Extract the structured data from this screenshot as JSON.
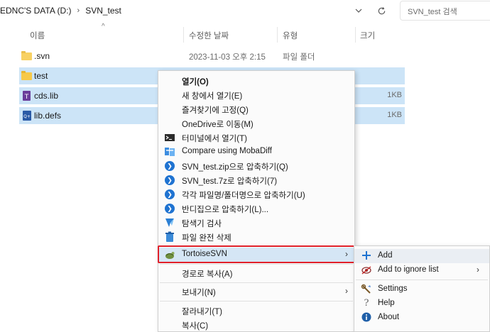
{
  "address": {
    "segments": [
      "EDNC'S DATA (D:)",
      "SVN_test"
    ],
    "separator": "›",
    "dropdown_icon": "chevron-down-icon",
    "refresh_icon": "refresh-icon"
  },
  "search": {
    "placeholder": "SVN_test 검색"
  },
  "columns": {
    "name": "이름",
    "modified": "수정한 날짜",
    "type": "유형",
    "size": "크기"
  },
  "files": [
    {
      "name": ".svn",
      "modified": "2023-11-03 오후 2:15",
      "type": "파일 폴더",
      "size": "",
      "icon": "folder-icon"
    },
    {
      "name": "test",
      "modified": "",
      "type": "",
      "size": "",
      "icon": "folder-icon"
    },
    {
      "name": "cds.lib",
      "modified": "",
      "type": "",
      "size": "1KB",
      "icon": "lib-file-icon"
    },
    {
      "name": "lib.defs",
      "modified": "",
      "type": "",
      "size": "1KB",
      "icon": "defs-file-icon"
    }
  ],
  "context_menu": {
    "items": [
      {
        "label": "열기(O)",
        "bold": true,
        "icon": ""
      },
      {
        "label": "새 창에서 열기(E)",
        "icon": ""
      },
      {
        "label": "즐겨찾기에 고정(Q)",
        "icon": ""
      },
      {
        "label": "OneDrive로 이동(M)",
        "icon": ""
      },
      {
        "label": "터미널에서 열기(T)",
        "icon": "terminal-icon"
      },
      {
        "label": "Compare using MobaDiff",
        "icon": "mobadiff-icon"
      },
      {
        "label": "SVN_test.zip으로 압축하기(Q)",
        "icon": "bandizip-icon"
      },
      {
        "label": "SVN_test.7z로 압축하기(7)",
        "icon": "bandizip-icon"
      },
      {
        "label": "각각 파일명/폴더명으로 압축하기(U)",
        "icon": "bandizip-icon"
      },
      {
        "label": "반디집으로 압축하기(L)...",
        "icon": "bandizip-icon"
      },
      {
        "label": "탐색기 검사",
        "icon": "explorer-scan-icon"
      },
      {
        "label": "파일 완전 삭제",
        "icon": "shred-icon"
      },
      {
        "label": "TortoiseSVN",
        "icon": "tortoisesvn-icon",
        "has_submenu": true
      },
      {
        "label": "경로로 복사(A)",
        "icon": ""
      },
      {
        "label": "보내기(N)",
        "icon": "",
        "has_submenu": true
      },
      {
        "label": "잘라내기(T)",
        "icon": ""
      },
      {
        "label": "복사(C)",
        "icon": ""
      }
    ],
    "submenu_arrow": "›"
  },
  "submenu": {
    "items": [
      {
        "label": "Add",
        "icon": "plus-icon",
        "highlighted": true
      },
      {
        "label": "Add to ignore list",
        "icon": "ignore-icon",
        "has_submenu": true
      },
      {
        "label": "Settings",
        "icon": "settings-icon"
      },
      {
        "label": "Help",
        "icon": "help-icon"
      },
      {
        "label": "About",
        "icon": "info-icon"
      }
    ]
  },
  "colors": {
    "selection": "#cce4f7",
    "highlight_box": "#e0202a",
    "add_icon": "#1f73d1"
  }
}
